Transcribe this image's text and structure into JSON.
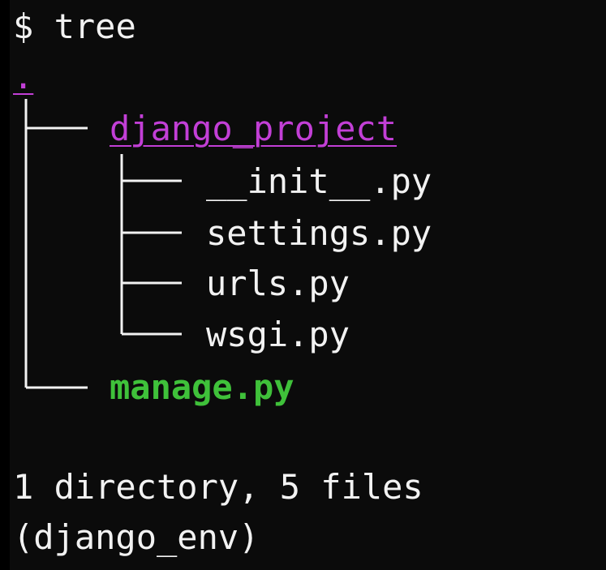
{
  "terminal": {
    "prompt_symbol": "$",
    "command": "tree",
    "root": ".",
    "tree": {
      "directory": "django_project",
      "directory_files": [
        "__init__.py",
        "settings.py",
        "urls.py",
        "wsgi.py"
      ],
      "root_file": "manage.py"
    },
    "summary": "1 directory, 5 files",
    "env_prompt": "(django_env)"
  },
  "colors": {
    "background": "#0b0b0b",
    "text": "#f2f2f2",
    "directory": "#c23fd6",
    "executable": "#3fc13a"
  }
}
